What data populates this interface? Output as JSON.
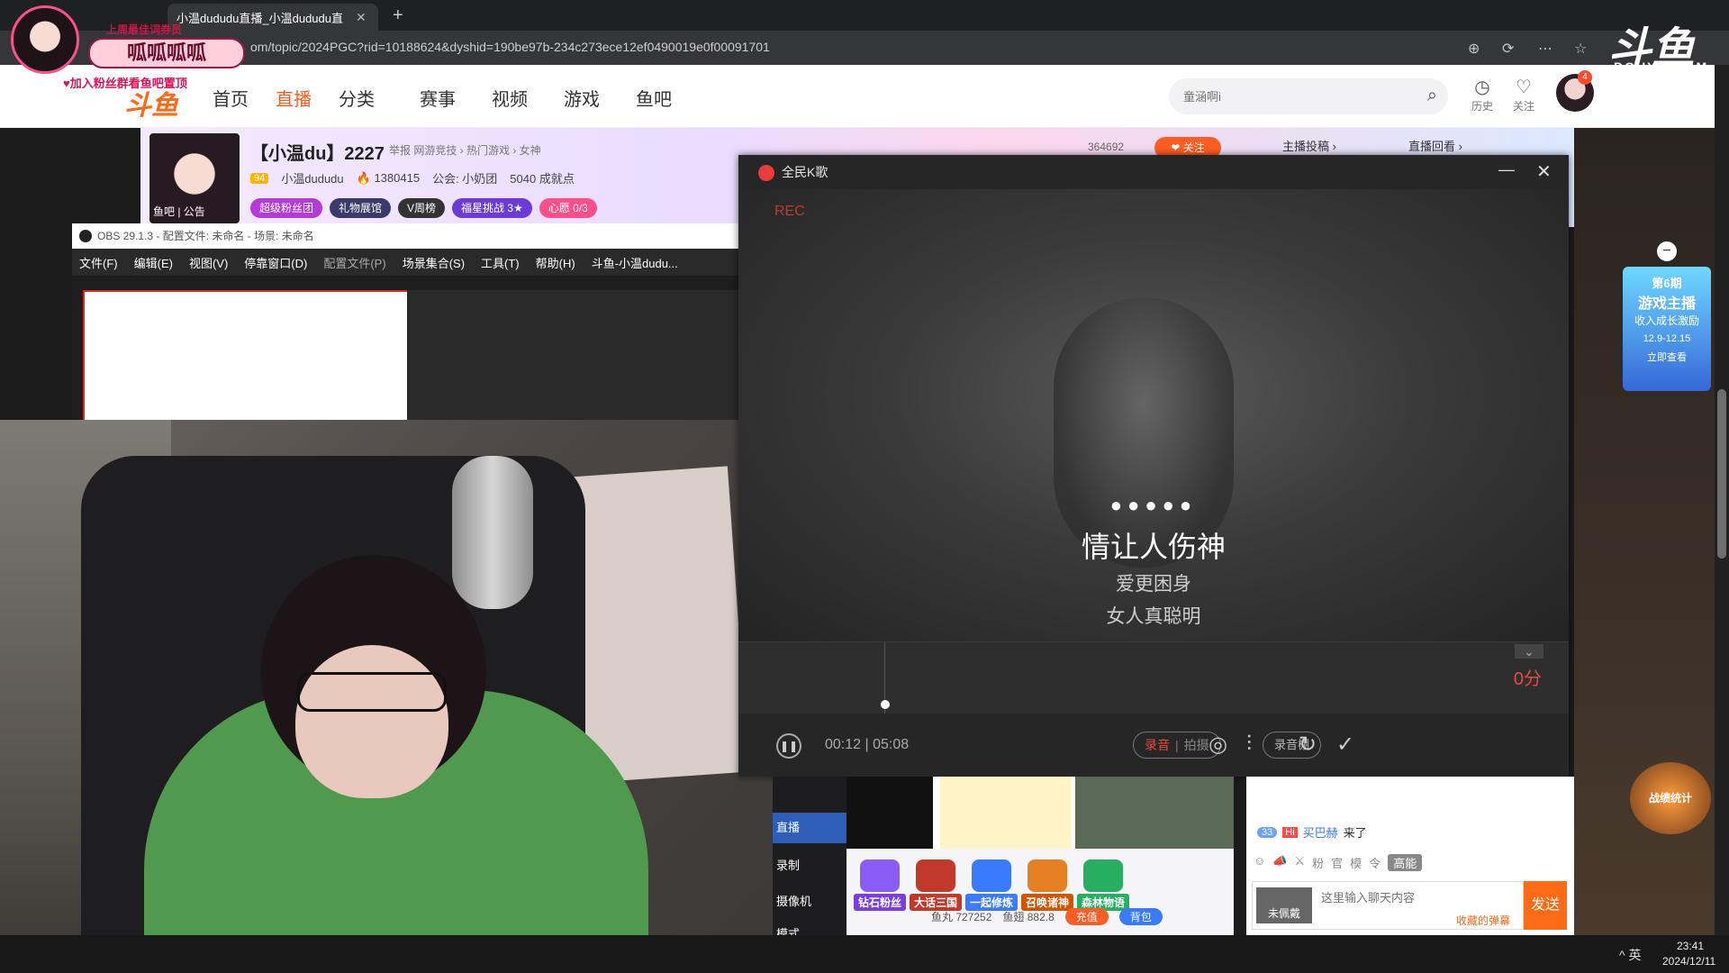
{
  "browser": {
    "tabs": [
      {
        "label": ""
      },
      {
        "label": ""
      },
      {
        "label": "小温dududu直播_小温dududu直"
      }
    ],
    "url": "om/topic/2024PGC?rid=10188624&dyshid=190be97b-234c273ece12ef0490019e0f00091701"
  },
  "overlay": {
    "top_text": "上周最佳词券员",
    "ribbon": "呱呱呱呱",
    "sub_text": "♥加入粉丝群看鱼吧置顶",
    "logo": "斗鱼",
    "watermark": "斗鱼",
    "watermark_sub": "DOUYU.COM"
  },
  "header": {
    "nav": [
      "首页",
      "直播",
      "分类",
      "赛事",
      "视频",
      "游戏",
      "鱼吧"
    ],
    "search_placeholder": "童涵啊i",
    "history": "历史",
    "follow": "关注",
    "badge": "4"
  },
  "room": {
    "title": "【小温du】2227",
    "links": "举报   网游竞技 › 热门游戏 › 女神",
    "level": "94",
    "name": "小温dududu",
    "hot": "🔥 1380415",
    "guild": "公会: 小奶团",
    "fans": "5040 成就点",
    "badges": [
      "超级粉丝团",
      "礼物展馆",
      "V周榜",
      "福星挑战 3★",
      "心愿  0/3"
    ],
    "yuba": "鱼吧 | 公告",
    "follow_count": "364692",
    "follow_btn": "❤ 关注",
    "side_links": [
      "主播投稿 ›",
      "直播回看 ›"
    ]
  },
  "obs": {
    "title": "OBS 29.1.3 - 配置文件: 未命名 - 场景: 未命名",
    "menu": [
      "文件(F)",
      "编辑(E)",
      "视图(V)",
      "停靠窗口(D)",
      "配置文件(P)",
      "场景集合(S)",
      "工具(T)",
      "帮助(H)",
      "斗鱼-小温dudu..."
    ]
  },
  "ktv": {
    "title": "全民K歌",
    "rec": "REC",
    "dots": "●●●●●",
    "lyric_main": "情让人伤神",
    "lyric_next1": "爱更困身",
    "lyric_next2": "女人真聪明",
    "score": "0分",
    "time": "00:12 | 05:08",
    "mode_rec": "录音",
    "mode_shot": "拍摄",
    "rec_shed": "录音棚"
  },
  "dock": {
    "items": [
      "直播",
      "录制",
      "摄像机",
      "模式"
    ]
  },
  "gifts": {
    "items": [
      "钻石粉丝",
      "大话三国",
      "一起修炼",
      "召唤诸神",
      "森林物语"
    ],
    "fish_balls": "鱼丸 727252",
    "fish_fins": "鱼翅 882.8",
    "recharge": "充值",
    "backpack": "背包"
  },
  "chat": {
    "fan_level": "33",
    "user": "买巴赫",
    "msg": "来了",
    "tools": [
      "☺",
      "📣",
      "⚔",
      "粉",
      "官",
      "模",
      "令"
    ],
    "high_energy": "高能",
    "fan_tag": "未佩戴",
    "input_placeholder": "这里输入聊天内容",
    "danmu_tip": "收藏的弹幕",
    "send": "发送"
  },
  "promo": {
    "lines": [
      "第6期",
      "游戏主播",
      "收入成长激励",
      "12.9-12.15",
      "立即查看"
    ]
  },
  "side": {
    "game_label": "战绩统计"
  },
  "taskbar": {
    "tray": "^  英",
    "time": "23:41",
    "date": "2024/12/11"
  }
}
